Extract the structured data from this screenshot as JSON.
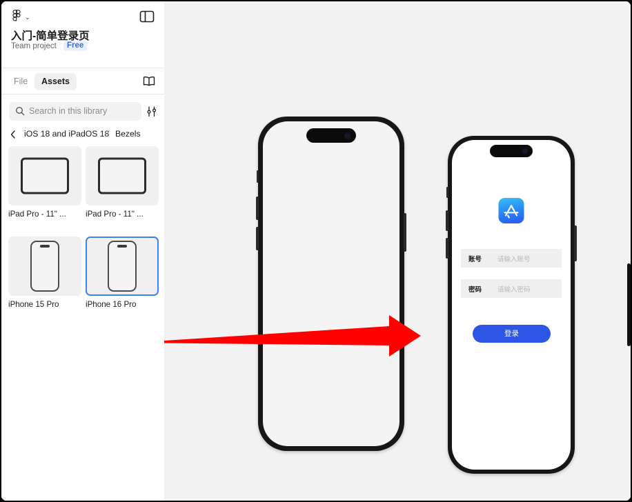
{
  "window": {
    "background": "#000000",
    "canvas_background": "#f2f2f2"
  },
  "sidebar": {
    "logo_icon": "figma-logo-icon",
    "logo_chevron": "⌄",
    "panel_toggle_icon": "panel-layout-icon",
    "project": {
      "title": "入门-简单登录页",
      "title_chevron": "⌄",
      "subtitle": "Team project",
      "badge": "Free",
      "badge_color": "#2f6fed"
    },
    "tabs": [
      {
        "label": "File",
        "active": false
      },
      {
        "label": "Assets",
        "active": true
      }
    ],
    "library_icon": "book-icon",
    "search": {
      "placeholder": "Search in this library",
      "icon": "search-icon",
      "filter_icon": "sliders-filter-icon"
    },
    "breadcrumb": {
      "back_icon": "chevron-left-icon",
      "library": "iOS 18 and iPadOS 18",
      "separator": "/",
      "folder": "Bezels"
    },
    "assets": [
      {
        "label": "iPad Pro - 11\" ...",
        "shape": "ipad",
        "selected": false
      },
      {
        "label": "iPad Pro - 11\" ...",
        "shape": "ipad",
        "selected": false
      },
      {
        "label": "iPhone 15 Pro",
        "shape": "iphone",
        "selected": false
      },
      {
        "label": "iPhone 16 Pro",
        "shape": "iphone",
        "selected": true
      }
    ],
    "selection_color": "#3b82f6"
  },
  "canvas": {
    "phone_large": {
      "name": "iPhone 16 Pro bezel",
      "screen_color": "#f4f4f4"
    },
    "phone_small": {
      "name": "简单登录页",
      "app_icon": "app-store-icon",
      "fields": [
        {
          "label": "账号",
          "placeholder": "请输入账号"
        },
        {
          "label": "密码",
          "placeholder": "请输入密码"
        }
      ],
      "button": {
        "label": "登录",
        "color": "#2e56e6"
      }
    },
    "annotation": {
      "type": "arrow",
      "color": "#ff0000",
      "direction": "right"
    }
  }
}
